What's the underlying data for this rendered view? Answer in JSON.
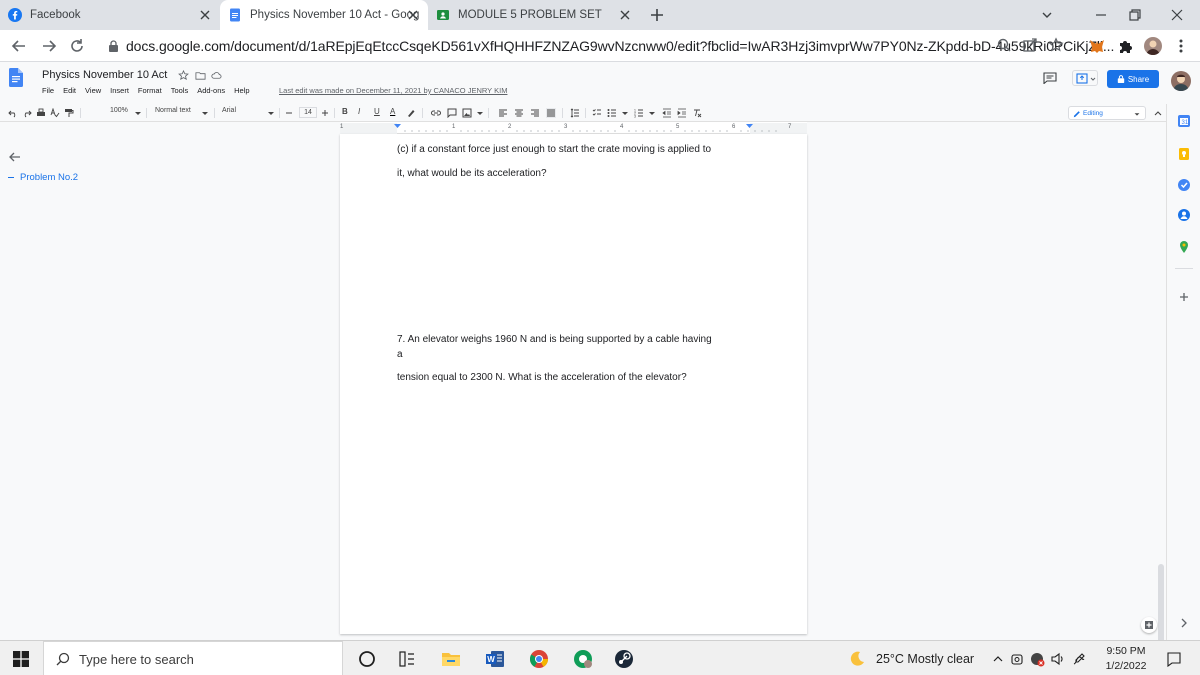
{
  "browser": {
    "tabs": [
      {
        "label": "Facebook",
        "icon": "facebook-icon",
        "active": false
      },
      {
        "label": "Physics November 10 Act - Goog",
        "icon": "google-docs-icon",
        "active": true
      },
      {
        "label": "MODULE 5 PROBLEM SET",
        "icon": "google-classroom-icon",
        "active": false
      }
    ],
    "url": "docs.google.com/document/d/1aREpjEqEtccCsqeKD561vXfHQHHFZNZAG9wvNzcnww0/edit?fbclid=IwAR3Hzj3imvprWw7PY0Nz-ZKpdd-bD-4u59kRi0PCiKjZli..."
  },
  "doc": {
    "title": "Physics November 10 Act",
    "menus": [
      "File",
      "Edit",
      "View",
      "Insert",
      "Format",
      "Tools",
      "Add-ons",
      "Help"
    ],
    "last_edit": "Last edit was made on December 11, 2021 by CANACO JENRY KIM",
    "share_label": "Share",
    "toolbar": {
      "zoom": "100%",
      "style": "Normal text",
      "font": "Arial",
      "font_size": "14",
      "bold": "B",
      "italic": "I",
      "underline": "U",
      "text_color": "A",
      "mode": "Editing"
    },
    "ruler_marks": [
      "1",
      "1",
      "2",
      "3",
      "4",
      "5",
      "6",
      "7"
    ],
    "outline": {
      "heading": "Problem No.2"
    },
    "body": {
      "line1": "(c) if a constant force just enough to start the crate moving is applied to",
      "line2": "it, what would be its acceleration?",
      "line3": "7. An elevator weighs 1960 N and is being supported by a cable having",
      "line4": "a",
      "line5": "tension equal to 2300 N. What is the acceleration of the elevator?"
    }
  },
  "taskbar": {
    "search_placeholder": "Type here to search",
    "weather": "25°C  Mostly clear",
    "time": "9:50 PM",
    "date": "1/2/2022"
  },
  "colors": {
    "accent": "#1a73e8",
    "docs_blue": "#4285f4",
    "facebook_blue": "#1877f2"
  }
}
